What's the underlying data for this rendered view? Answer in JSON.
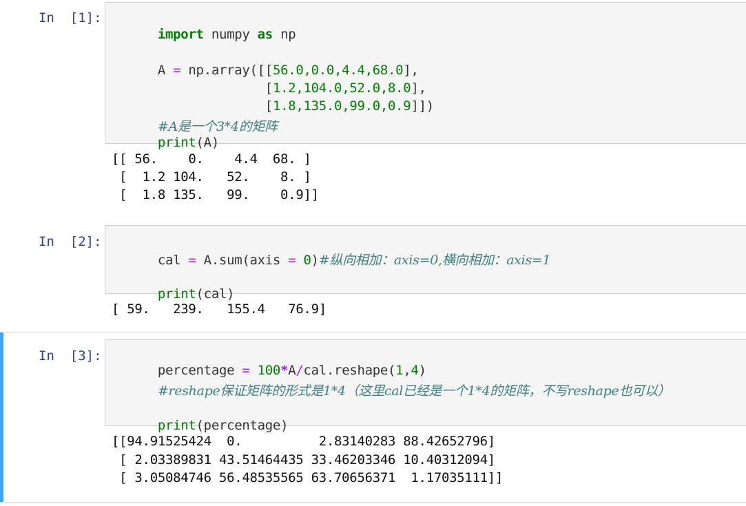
{
  "cells": [
    {
      "prompt": "In  [1]:",
      "code": {
        "line1": {
          "kw1": "import",
          "mod": " numpy ",
          "kw2": "as",
          "alias": " np"
        },
        "line2": {
          "a": "A ",
          "eq": "=",
          "b": " np.array([[",
          "nums": "56.0,0.0,4.4,68.0",
          "end": "],"
        },
        "line3": {
          "indent": "              [",
          "nums": "1.2,104.0,52.0,8.0",
          "end": "],"
        },
        "line4": {
          "indent": "              [",
          "nums": "1.8,135.0,99.0,0.9",
          "end": "]])"
        },
        "line5": {
          "comment": "#A是一个3*4的矩阵"
        },
        "line6": {
          "fn": "print",
          "args": "(A)"
        }
      },
      "output": [
        "[[ 56.    0.    4.4  68. ]",
        " [  1.2 104.   52.    8. ]",
        " [  1.8 135.   99.    0.9]]"
      ]
    },
    {
      "prompt": "In  [2]:",
      "code": {
        "line1": {
          "a": "cal ",
          "eq": "=",
          "b": " A.sum(axis ",
          "eq2": "=",
          "c": " ",
          "num": "0",
          "d": ")",
          "comment": "#纵向相加：axis=0,横向相加：axis=1"
        },
        "line2": {
          "fn": "print",
          "args": "(cal)"
        }
      },
      "output": [
        "[ 59.   239.   155.4   76.9]"
      ]
    },
    {
      "prompt": "In  [3]:",
      "code": {
        "line1": {
          "a": "percentage ",
          "eq": "=",
          "sp": " ",
          "num": "100",
          "mul": "*",
          "b": "A",
          "div": "/",
          "c": "cal.reshape(",
          "n1": "1",
          "comma": ",",
          "n2": "4",
          "d": ")"
        },
        "line2": {
          "comment": "#reshape保证矩阵的形式是1*4（这里cal已经是一个1*4的矩阵，不写reshape也可以）"
        },
        "line3": {
          "fn": "print",
          "args": "(percentage)"
        }
      },
      "output": [
        "[[94.91525424  0.          2.83140283 88.42652796]",
        " [ 2.03389831 43.51464435 33.46203346 10.40312094]",
        " [ 3.05084746 56.48535565 63.70656371  1.17035111]]"
      ]
    }
  ]
}
